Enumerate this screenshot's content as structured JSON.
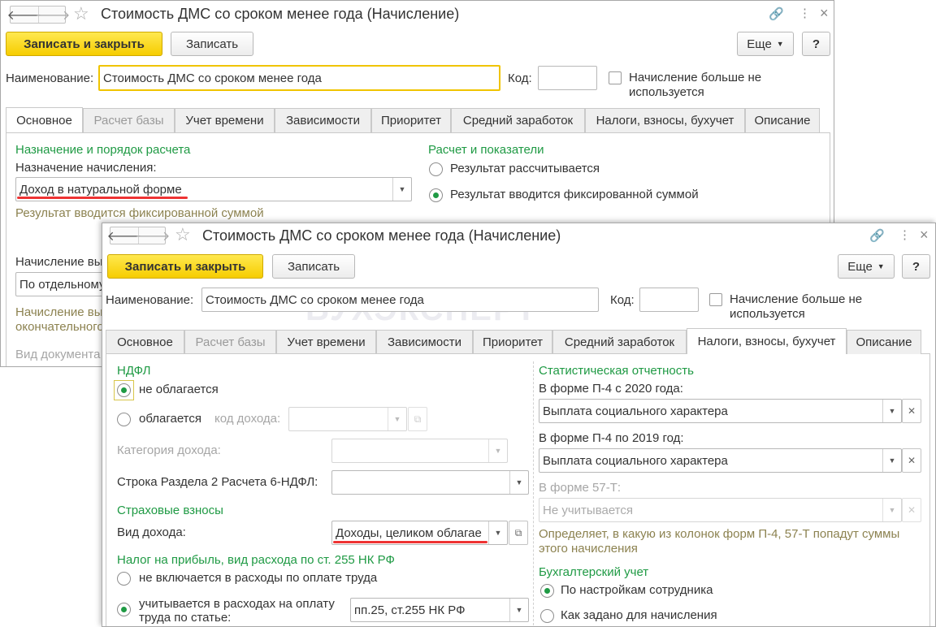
{
  "window_back": {
    "title": "Стоимость ДМС со сроком менее года (Начисление)",
    "nav": {
      "back": "🡐",
      "forward": "🡒"
    },
    "icons": {
      "link": "link-icon",
      "more": "⋮",
      "close": "×"
    },
    "toolbar": {
      "save_close": "Записать и закрыть",
      "save": "Записать",
      "more": "Еще",
      "help": "?"
    },
    "name_label": "Наименование:",
    "name_value": "Стоимость ДМС со сроком менее года",
    "code_label": "Код:",
    "code_value": "",
    "unused_label": "Начисление больше не используется",
    "tabs": [
      "Основное",
      "Расчет базы",
      "Учет времени",
      "Зависимости",
      "Приоритет",
      "Средний заработок",
      "Налоги, взносы, бухучет",
      "Описание"
    ],
    "active_tab": "Основное",
    "left": {
      "section_title": "Назначение и порядок расчета",
      "purpose_label": "Назначение начисления:",
      "purpose_value": "Доход в натуральной форме",
      "result_note": "Результат вводится фиксированной суммой",
      "accrual_label": "Начисление вы",
      "accrual_value": "По отдельному",
      "final_label_1": "Начисление вы",
      "final_label_2": "окончательного",
      "doc_type_label": "Вид документа"
    },
    "right": {
      "section_title": "Расчет и показатели",
      "opt_calculated": "Результат рассчитывается",
      "opt_fixed": "Результат вводится фиксированной суммой"
    }
  },
  "window_front": {
    "title": "Стоимость ДМС со сроком менее года (Начисление)",
    "nav": {
      "back": "🡐",
      "forward": "🡒"
    },
    "icons": {
      "link": "link-icon",
      "more": "⋮",
      "close": "×"
    },
    "toolbar": {
      "save_close": "Записать и закрыть",
      "save": "Записать",
      "more": "Еще",
      "help": "?"
    },
    "name_label": "Наименование:",
    "name_value": "Стоимость ДМС со сроком менее года",
    "code_label": "Код:",
    "code_value": "",
    "unused_label_1": "Начисление больше не",
    "unused_label_2": "используется",
    "watermark": "БУХЭКСПЕРТ",
    "tabs": [
      "Основное",
      "Расчет базы",
      "Учет времени",
      "Зависимости",
      "Приоритет",
      "Средний заработок",
      "Налоги, взносы, бухучет",
      "Описание"
    ],
    "active_tab": "Налоги, взносы, бухучет",
    "ndfl": {
      "title": "НДФЛ",
      "not_taxed": "не облагается",
      "taxed": "облагается",
      "income_code_label": "код дохода:",
      "income_code_value": "",
      "category_label": "Категория дохода:",
      "category_value": "",
      "row_label": "Строка Раздела 2 Расчета 6-НДФЛ:",
      "row_value": ""
    },
    "insurance": {
      "title": "Страховые взносы",
      "income_type_label": "Вид дохода:",
      "income_type_value": "Доходы, целиком облагае"
    },
    "profit_tax": {
      "title": "Налог на прибыль, вид расхода по ст. 255 НК РФ",
      "not_included": "не включается в расходы по оплате труда",
      "included_1": "учитывается в расходах на оплату",
      "included_2": "труда по статье:",
      "article_value": "пп.25, ст.255 НК РФ"
    },
    "stats": {
      "title": "Статистическая отчетность",
      "p4_2020_label": "В форме П-4 с 2020 года:",
      "p4_2020_value": "Выплата социального характера",
      "p4_2019_label": "В форме П-4 по 2019 год:",
      "p4_2019_value": "Выплата социального характера",
      "f57_label": "В форме 57-Т:",
      "f57_value": "Не учитывается",
      "note_1": "Определяет, в какую из колонок форм П-4, 57-Т попадут суммы",
      "note_2": "этого начисления"
    },
    "accounting": {
      "title": "Бухгалтерский учет",
      "by_employee": "По настройкам сотрудника",
      "by_accrual": "Как задано для начисления"
    }
  },
  "colors": {
    "accent_green": "#1f9a44",
    "button_yellow": "#f6cd00",
    "highlight_red": "#e33333",
    "note_olive": "#8c8250"
  }
}
